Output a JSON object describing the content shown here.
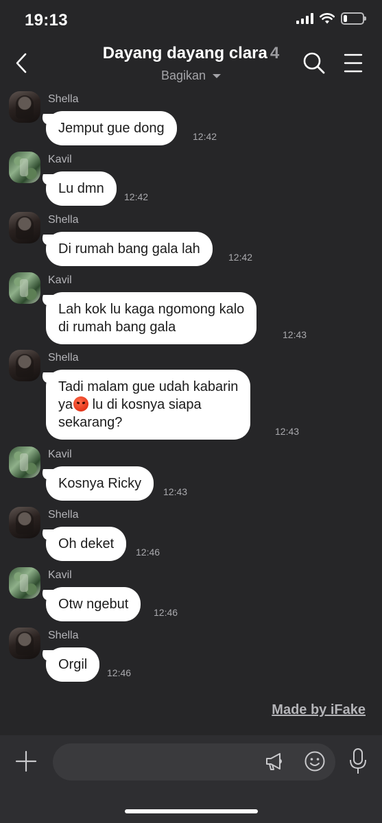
{
  "status_bar": {
    "time": "19:13"
  },
  "header": {
    "title": "Dayang dayang clara",
    "member_count": "4",
    "subtitle": "Bagikan"
  },
  "messages": [
    {
      "sender": "Shella",
      "avatar": "shella",
      "text": "Jemput gue dong",
      "time": "12:42"
    },
    {
      "sender": "Kavil",
      "avatar": "kavil",
      "text": "Lu dmn",
      "time": "12:42"
    },
    {
      "sender": "Shella",
      "avatar": "shella",
      "text": "Di rumah bang gala lah",
      "time": "12:42"
    },
    {
      "sender": "Kavil",
      "avatar": "kavil",
      "text": "Lah kok lu kaga ngomong kalo\ndi rumah bang gala",
      "time": "12:43"
    },
    {
      "sender": "Shella",
      "avatar": "shella",
      "text_before_emoji": "Tadi malam gue udah kabarin\nya",
      "emoji": "pouting-face",
      "text_after_emoji": " lu di kosnya siapa\nsekarang?",
      "time": "12:43"
    },
    {
      "sender": "Kavil",
      "avatar": "kavil",
      "text": "Kosnya Ricky",
      "time": "12:43"
    },
    {
      "sender": "Shella",
      "avatar": "shella",
      "text": "Oh deket",
      "time": "12:46"
    },
    {
      "sender": "Kavil",
      "avatar": "kavil",
      "text": "Otw ngebut",
      "time": "12:46"
    },
    {
      "sender": "Shella",
      "avatar": "shella",
      "text": "Orgil",
      "time": "12:46"
    }
  ],
  "watermark": "Made by iFake",
  "input": {
    "value": "",
    "placeholder": ""
  }
}
